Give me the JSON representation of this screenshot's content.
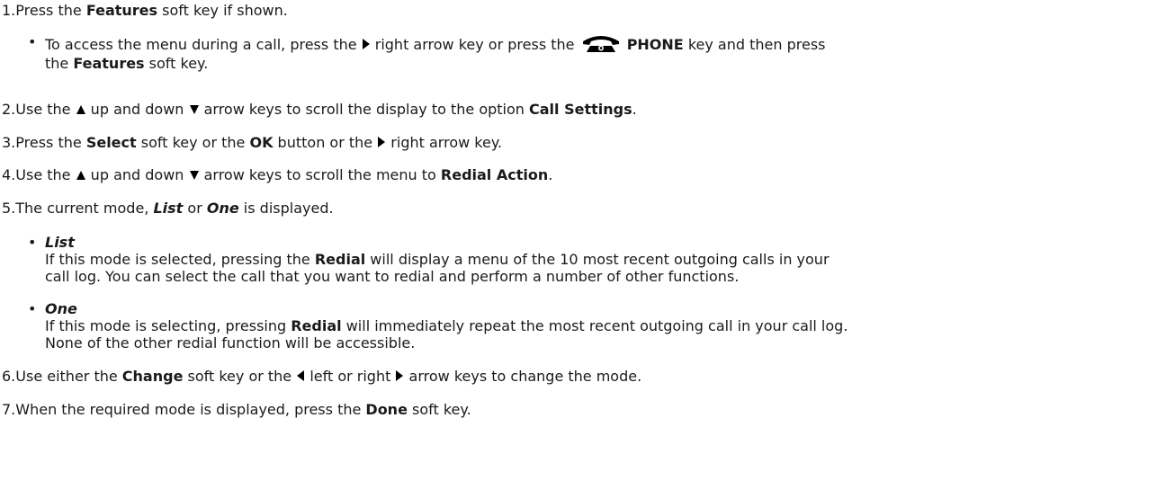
{
  "steps": [
    {
      "num": "1.",
      "a": "Press the ",
      "b": "Features",
      "c": " soft key if shown."
    },
    {
      "num": "2.",
      "a": "Use the ",
      "b": " up and down ",
      "c": " arrow keys to scroll the display to the option ",
      "d": "Call Settings",
      "e": "."
    },
    {
      "num": "3.",
      "a": "Press the ",
      "b": "Select",
      "c": " soft key or the ",
      "d": "OK",
      "e": " button or the ",
      "f": " right arrow key."
    },
    {
      "num": "4.",
      "a": "Use the ",
      "b": " up and down ",
      "c": " arrow keys to scroll the menu to ",
      "d": "Redial Action",
      "e": "."
    },
    {
      "num": "5.",
      "a": "The current mode, ",
      "b": "List",
      "c": " or ",
      "d": "One",
      "e": " is displayed."
    },
    {
      "num": "6.",
      "a": "Use either the ",
      "b": "Change",
      "c": " soft key or the ",
      "d": " left or right ",
      "e": " arrow keys to change the mode."
    },
    {
      "num": "7.",
      "a": "When the required mode is displayed, press the ",
      "b": "Done",
      "c": " soft key."
    }
  ],
  "step1_sub": {
    "a": "To access the menu during a call, press the ",
    "b": " right arrow key or press the ",
    "c": "PHONE",
    "d": " key and then press",
    "e": "the ",
    "f": "Features",
    "g": " soft key."
  },
  "modes": [
    {
      "title": "List",
      "line1a": "If this mode is selected, pressing the ",
      "line1b": "Redial",
      "line1c": " will display a menu of the 10 most recent outgoing calls in your",
      "line2": "call log. You can select the call that you want to redial and perform a number of other functions."
    },
    {
      "title": "One",
      "line1a": "If this mode is selecting, pressing ",
      "line1b": "Redial",
      "line1c": " will immediately repeat the most recent outgoing call in your call log.",
      "line2": "None of the other redial function will be accessible."
    }
  ],
  "icons": {
    "right": "right-arrow-key-icon",
    "left": "left-arrow-key-icon",
    "up": "up-arrow-key-icon",
    "down": "down-arrow-key-icon",
    "phone": "phone-key-icon"
  }
}
